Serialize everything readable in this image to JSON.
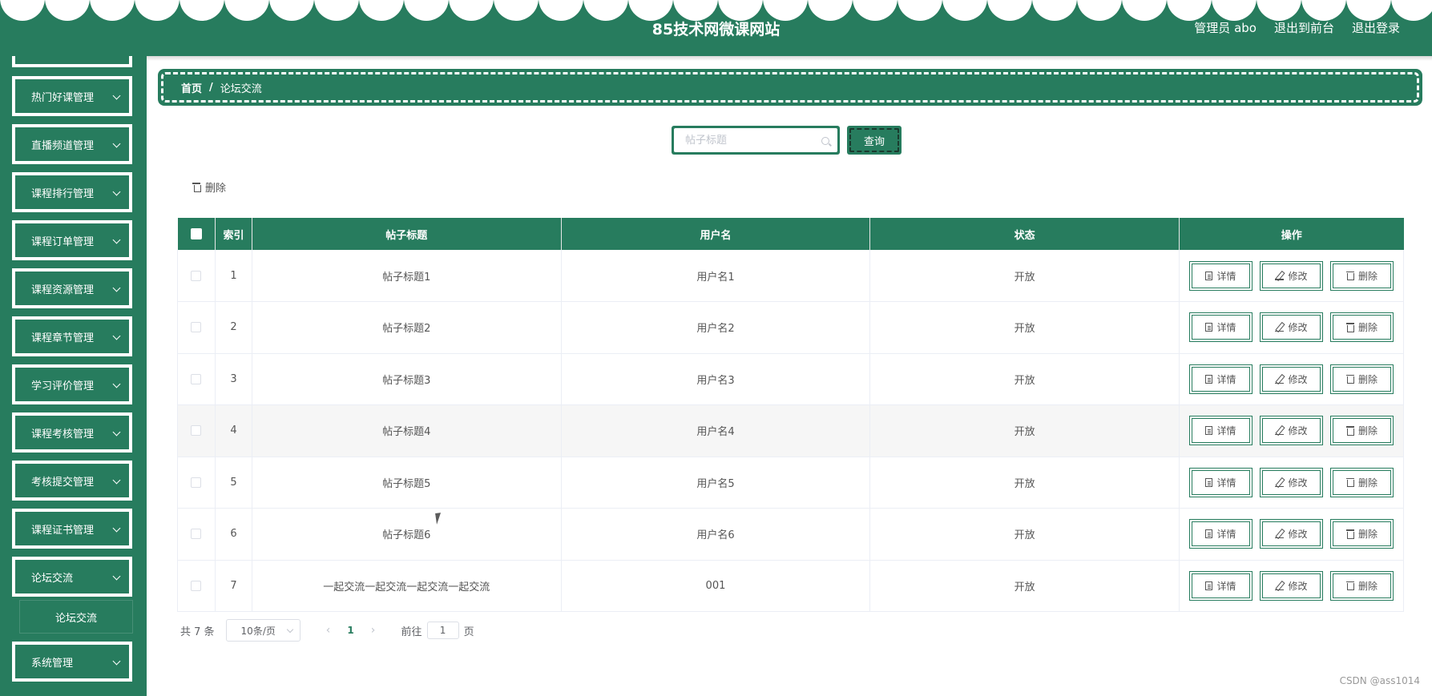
{
  "header": {
    "site_title": "85技术网微课网站",
    "admin_label": "管理员 abo",
    "to_frontend": "退出到前台",
    "logout": "退出登录",
    "brand_color": "#277c5e"
  },
  "sidebar": {
    "items": [
      {
        "label": "热门好课管理"
      },
      {
        "label": "直播频道管理"
      },
      {
        "label": "课程排行管理"
      },
      {
        "label": "课程订单管理"
      },
      {
        "label": "课程资源管理"
      },
      {
        "label": "课程章节管理"
      },
      {
        "label": "学习评价管理"
      },
      {
        "label": "课程考核管理"
      },
      {
        "label": "考核提交管理"
      },
      {
        "label": "课程证书管理"
      },
      {
        "label": "论坛交流"
      },
      {
        "label": "系统管理"
      }
    ],
    "submenu_label": "论坛交流"
  },
  "breadcrumb": {
    "home": "首页",
    "separator": "/",
    "current": "论坛交流"
  },
  "search": {
    "placeholder": "帖子标题",
    "query_label": "查询"
  },
  "toolbar": {
    "delete_label": "删除"
  },
  "table": {
    "headers": [
      "索引",
      "帖子标题",
      "用户名",
      "状态",
      "操作"
    ],
    "rows": [
      {
        "index": "1",
        "title": "帖子标题1",
        "user": "用户名1",
        "status": "开放"
      },
      {
        "index": "2",
        "title": "帖子标题2",
        "user": "用户名2",
        "status": "开放"
      },
      {
        "index": "3",
        "title": "帖子标题3",
        "user": "用户名3",
        "status": "开放"
      },
      {
        "index": "4",
        "title": "帖子标题4",
        "user": "用户名4",
        "status": "开放"
      },
      {
        "index": "5",
        "title": "帖子标题5",
        "user": "用户名5",
        "status": "开放"
      },
      {
        "index": "6",
        "title": "帖子标题6",
        "user": "用户名6",
        "status": "开放"
      },
      {
        "index": "7",
        "title": "一起交流一起交流一起交流一起交流",
        "user": "001",
        "status": "开放"
      }
    ],
    "actions": {
      "detail": "详情",
      "edit": "修改",
      "delete": "删除"
    }
  },
  "pagination": {
    "total": "共 7 条",
    "page_size": "10条/页",
    "current_page": "1",
    "goto_label": "前往",
    "goto_value": "1",
    "page_unit": "页"
  },
  "watermark": "CSDN @ass1014"
}
